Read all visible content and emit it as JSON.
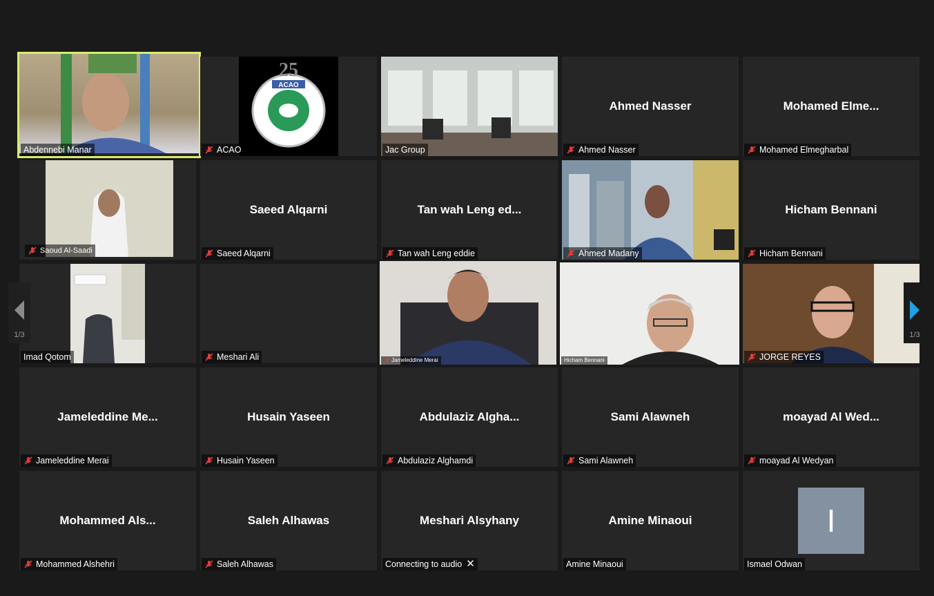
{
  "pager": {
    "left_page": "1/3",
    "right_page": "1/3"
  },
  "colors": {
    "active_border": "#d9ec6e",
    "tile_bg": "#262626",
    "accent_arrow": "#1fa0e6",
    "muted_mic": "#e23b3b"
  },
  "tiles": [
    {
      "label": "Abdennebi Manar",
      "muted": false,
      "type": "video",
      "active": true
    },
    {
      "label": "ACAO",
      "muted": true,
      "type": "logo",
      "logo_title": "ACAO",
      "logo_number": "25"
    },
    {
      "label": "Jac Group",
      "muted": false,
      "type": "video"
    },
    {
      "label": "Ahmed Nasser",
      "name": "Ahmed Nasser",
      "muted": true,
      "type": "name"
    },
    {
      "label": "Mohamed Elmegharbal",
      "name": "Mohamed  Elme...",
      "muted": true,
      "type": "name"
    },
    {
      "label": "Saoud Al-Saadi",
      "muted": true,
      "type": "video"
    },
    {
      "label": "Saeed Alqarni",
      "name": "Saeed Alqarni",
      "muted": true,
      "type": "name"
    },
    {
      "label": "Tan wah Leng eddie",
      "name": "Tan wah Leng ed...",
      "muted": true,
      "type": "name"
    },
    {
      "label": "Ahmed Madany",
      "muted": true,
      "type": "video"
    },
    {
      "label": "Hicham Bennani",
      "name": "Hicham Bennani",
      "muted": true,
      "type": "name"
    },
    {
      "label": "Imad Qotom",
      "muted": false,
      "type": "video"
    },
    {
      "label": "Meshari Ali",
      "muted": true,
      "type": "blank"
    },
    {
      "label": "Jameleddine Merai",
      "muted": true,
      "type": "video",
      "small_label": true
    },
    {
      "label": "Hicham Bennani",
      "muted": false,
      "type": "video",
      "small_label": true
    },
    {
      "label": "JORGE REYES",
      "muted": true,
      "type": "video"
    },
    {
      "label": "Jameleddine Merai",
      "name": "Jameleddine  Me...",
      "muted": true,
      "type": "name"
    },
    {
      "label": "Husain Yaseen",
      "name": "Husain Yaseen",
      "muted": true,
      "type": "name"
    },
    {
      "label": "Abdulaziz Alghamdi",
      "name": "Abdulaziz  Algha...",
      "muted": true,
      "type": "name"
    },
    {
      "label": "Sami Alawneh",
      "name": "Sami Alawneh",
      "muted": true,
      "type": "name"
    },
    {
      "label": "moayad Al Wedyan",
      "name": "moayad  Al Wed...",
      "muted": true,
      "type": "name"
    },
    {
      "label": "Mohammed Alshehri",
      "name": "Mohammed  Als...",
      "muted": true,
      "type": "name"
    },
    {
      "label": "Saleh Alhawas",
      "name": "Saleh Alhawas",
      "muted": true,
      "type": "name"
    },
    {
      "label": "Connecting to audio",
      "name": "Meshari Alsyhany",
      "muted": false,
      "type": "name",
      "connecting": true
    },
    {
      "label": "Amine Minaoui",
      "name": "Amine Minaoui",
      "muted": false,
      "type": "name"
    },
    {
      "label": "Ismael Odwan",
      "muted": false,
      "type": "avatar",
      "initial": "I"
    }
  ]
}
